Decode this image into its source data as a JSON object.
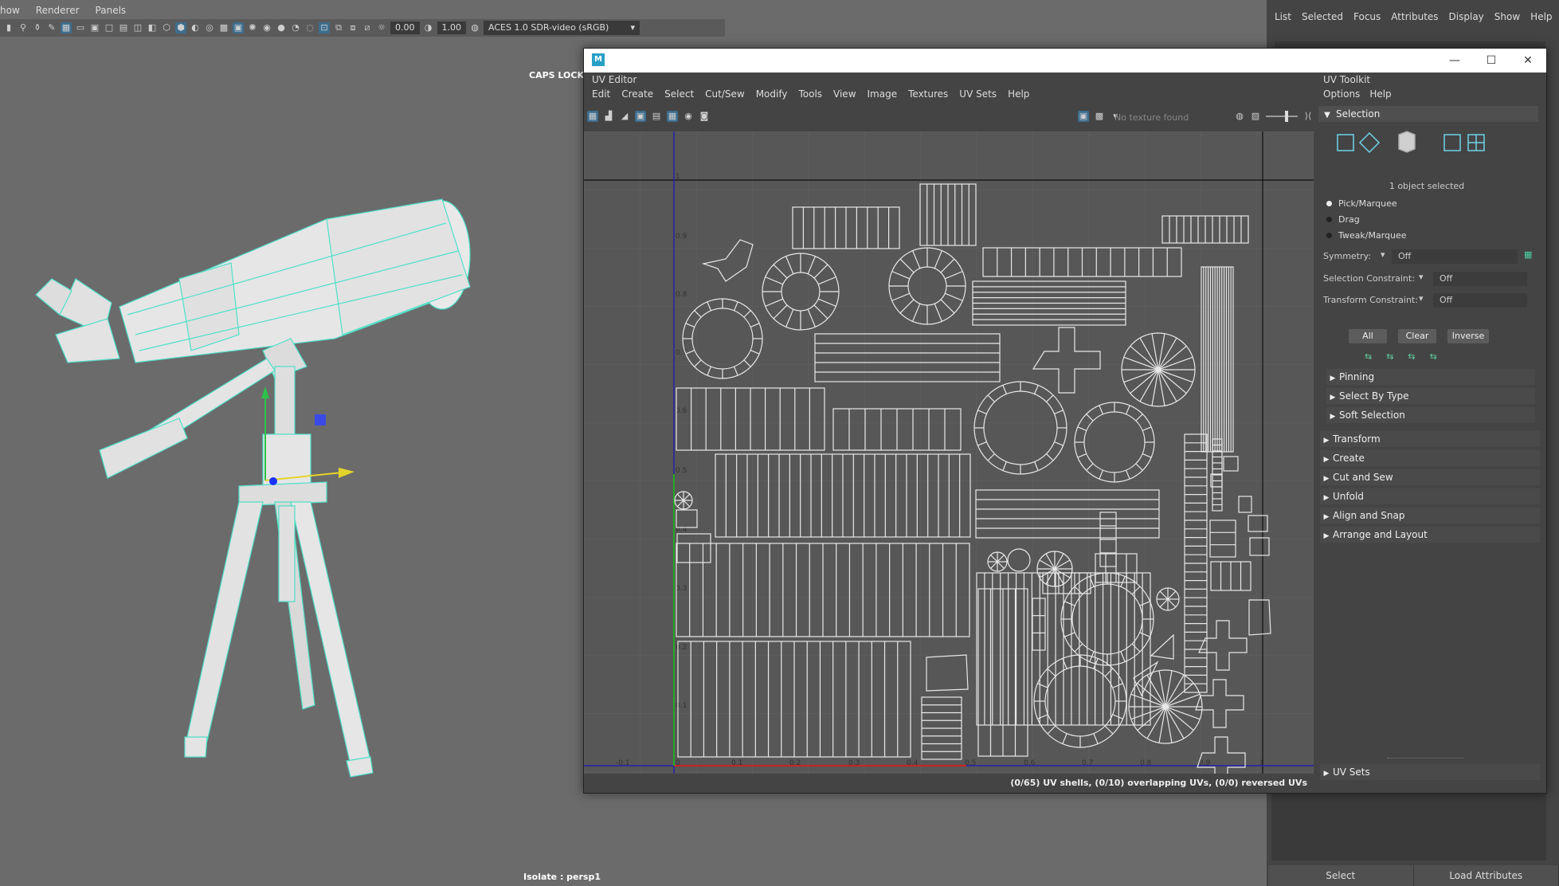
{
  "viewport": {
    "menu": [
      "how",
      "Renderer",
      "Panels"
    ],
    "fields": {
      "exposure": "0.00",
      "gamma": "1.00"
    },
    "color_space": "ACES 1.0 SDR-video (sRGB)",
    "caps_lock": "CAPS LOCK O",
    "isolate": "Isolate : persp1"
  },
  "attribute_panel": {
    "menu": [
      "List",
      "Selected",
      "Focus",
      "Attributes",
      "Display",
      "Show",
      "Help"
    ],
    "bottom_buttons": [
      "Select",
      "Load Attributes"
    ]
  },
  "uv_editor": {
    "title": "UV Editor",
    "menu": [
      "Edit",
      "Create",
      "Select",
      "Cut/Sew",
      "Modify",
      "Tools",
      "View",
      "Image",
      "Textures",
      "UV Sets",
      "Help"
    ],
    "texture_msg": "No texture found",
    "status": "(0/65) UV shells, (0/10) overlapping UVs, (0/0) reversed UVs",
    "axis_labels_v": [
      "1",
      "0.9",
      "0.8",
      "0.7",
      "0.6",
      "0.5",
      "0.4",
      "0.3",
      "0.2",
      "0.1"
    ],
    "axis_labels_u": [
      "-0.1",
      "0",
      "0.1",
      "0.2",
      "0.3",
      "0.4",
      "0.5",
      "0.6",
      "0.7",
      "0.8",
      "0.9",
      "1"
    ]
  },
  "toolkit": {
    "title": "UV Toolkit",
    "menu": [
      "Options",
      "Help"
    ],
    "selection_header": "Selection",
    "object_selected": "1 object selected",
    "modes": [
      "Pick/Marquee",
      "Drag",
      "Tweak/Marquee"
    ],
    "symmetry_label": "Symmetry:",
    "symmetry_value": "Off",
    "sel_constraint_label": "Selection Constraint:",
    "sel_constraint_value": "Off",
    "xf_constraint_label": "Transform Constraint:",
    "xf_constraint_value": "Off",
    "buttons": [
      "All",
      "Clear",
      "Inverse"
    ],
    "subsections": [
      "Pinning",
      "Select By Type",
      "Soft Selection"
    ],
    "sections": [
      "Transform",
      "Create",
      "Cut and Sew",
      "Unfold",
      "Align and Snap",
      "Arrange and Layout"
    ],
    "uv_sets": "UV Sets"
  }
}
